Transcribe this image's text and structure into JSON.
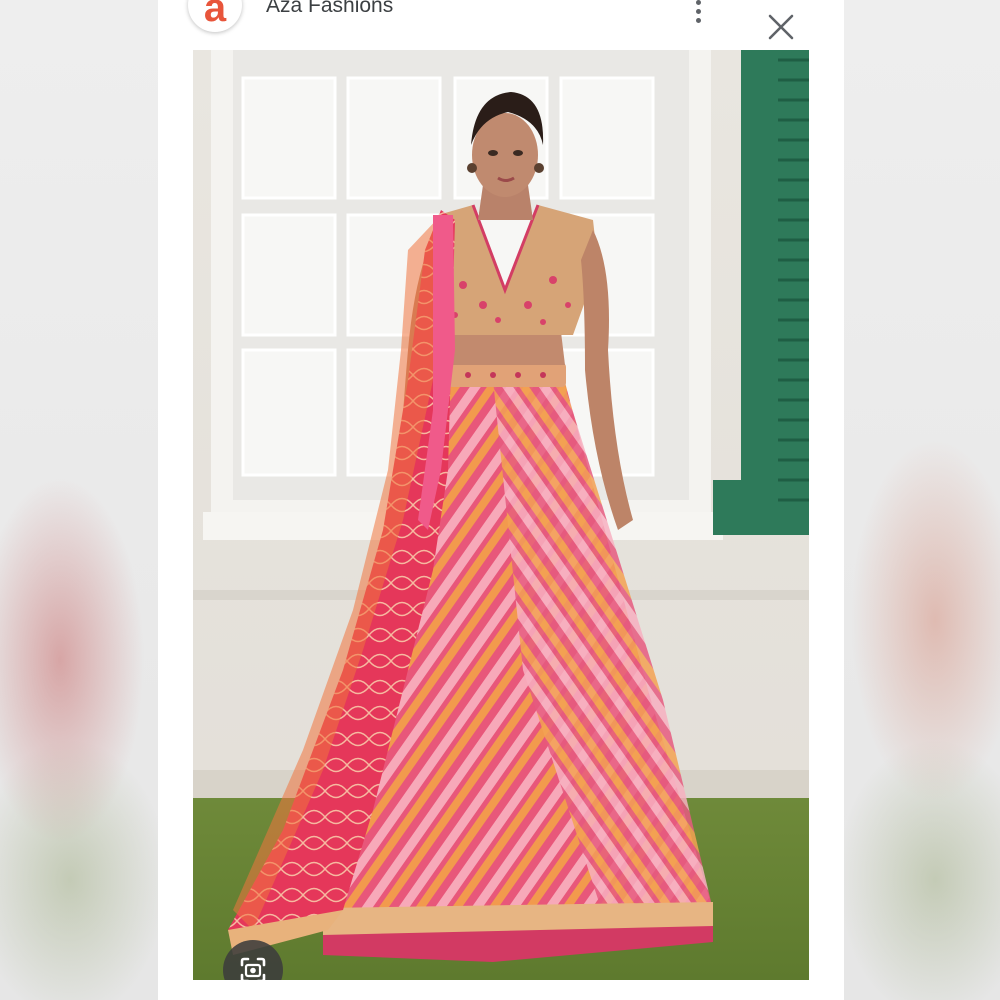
{
  "header": {
    "brand_letter": "a",
    "brand_name": "Aza Fashions",
    "more_icon": "more-vert-icon",
    "close_icon": "close-icon"
  },
  "image": {
    "subject": "model-in-lehenga"
  },
  "lens_button": {
    "icon": "lens-camera-icon"
  },
  "colors": {
    "brand": "#e8553b",
    "window_shutter": "#2e7a5a",
    "skirt_pink": "#e8577a",
    "skirt_orange": "#f19a4a",
    "dupatta": "#e83a6a"
  }
}
